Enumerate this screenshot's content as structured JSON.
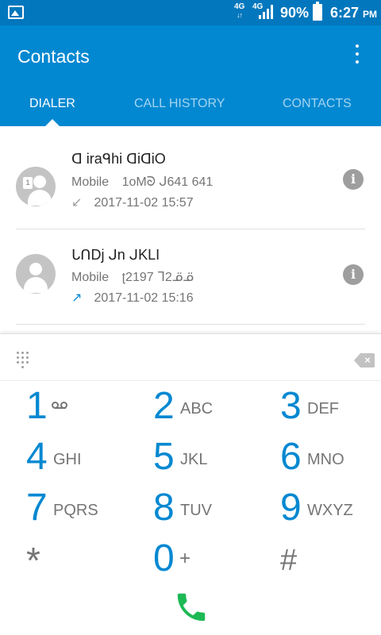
{
  "status_bar": {
    "network_1": "4G",
    "network_2": "4G",
    "battery": "90%",
    "time": "6:27",
    "ampm": "PM"
  },
  "app_bar": {
    "title": "Contacts",
    "tabs": [
      {
        "label": "DIALER",
        "active": true
      },
      {
        "label": "CALL HISTORY",
        "active": false
      },
      {
        "label": "CONTACTS",
        "active": false
      }
    ]
  },
  "call_log": [
    {
      "name": "ᗡ iraᑫhi ᗡiᗡiO",
      "type": "Mobile",
      "number": "1oMᘐ ᒍ641 641",
      "direction": "incoming",
      "date": "2017-11-02",
      "time": "15:57"
    },
    {
      "name": "ᒐᑎDj ᒍn ᒍKLI",
      "type": "Mobile",
      "number": "ʈ2197 ᒣ2ᓆᓆ",
      "direction": "outgoing",
      "date": "2017-11-02",
      "time": "15:16"
    }
  ],
  "dialpad": {
    "keys": [
      {
        "digit": "1",
        "letters": ""
      },
      {
        "digit": "2",
        "letters": "ABC"
      },
      {
        "digit": "3",
        "letters": "DEF"
      },
      {
        "digit": "4",
        "letters": "GHI"
      },
      {
        "digit": "5",
        "letters": "JKL"
      },
      {
        "digit": "6",
        "letters": "MNO"
      },
      {
        "digit": "7",
        "letters": "PQRS"
      },
      {
        "digit": "8",
        "letters": "TUV"
      },
      {
        "digit": "9",
        "letters": "WXYZ"
      },
      {
        "digit": "*",
        "letters": ""
      },
      {
        "digit": "0",
        "letters": "+"
      },
      {
        "digit": "#",
        "letters": ""
      }
    ]
  },
  "colors": {
    "primary": "#0288d1",
    "primary_dark": "#0277bd",
    "call_green": "#1db954"
  },
  "icons": [
    "image-icon",
    "signal-icon",
    "battery-icon",
    "overflow-menu-icon",
    "avatar-icon",
    "info-icon",
    "dialpad-grid-icon",
    "backspace-icon",
    "voicemail-icon",
    "call-icon"
  ]
}
